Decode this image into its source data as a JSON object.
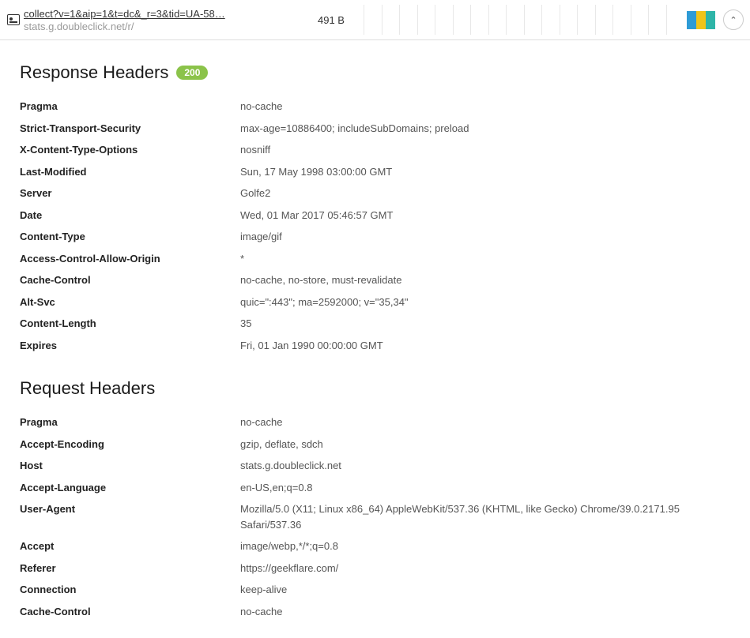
{
  "request": {
    "url": "collect?v=1&aip=1&t=dc&_r=3&tid=UA-58…",
    "host": "stats.g.doubleclick.net/r/",
    "size": "491 B"
  },
  "responseHeaders": {
    "title": "Response Headers",
    "status": "200",
    "items": [
      {
        "name": "Pragma",
        "value": "no-cache"
      },
      {
        "name": "Strict-Transport-Security",
        "value": "max-age=10886400; includeSubDomains; preload"
      },
      {
        "name": "X-Content-Type-Options",
        "value": "nosniff"
      },
      {
        "name": "Last-Modified",
        "value": "Sun, 17 May 1998 03:00:00 GMT"
      },
      {
        "name": "Server",
        "value": "Golfe2"
      },
      {
        "name": "Date",
        "value": "Wed, 01 Mar 2017 05:46:57 GMT"
      },
      {
        "name": "Content-Type",
        "value": "image/gif"
      },
      {
        "name": "Access-Control-Allow-Origin",
        "value": "*"
      },
      {
        "name": "Cache-Control",
        "value": "no-cache, no-store, must-revalidate"
      },
      {
        "name": "Alt-Svc",
        "value": "quic=\":443\"; ma=2592000; v=\"35,34\""
      },
      {
        "name": "Content-Length",
        "value": "35"
      },
      {
        "name": "Expires",
        "value": "Fri, 01 Jan 1990 00:00:00 GMT"
      }
    ]
  },
  "requestHeaders": {
    "title": "Request Headers",
    "items": [
      {
        "name": "Pragma",
        "value": "no-cache"
      },
      {
        "name": "Accept-Encoding",
        "value": "gzip, deflate, sdch"
      },
      {
        "name": "Host",
        "value": "stats.g.doubleclick.net"
      },
      {
        "name": "Accept-Language",
        "value": "en-US,en;q=0.8"
      },
      {
        "name": "User-Agent",
        "value": "Mozilla/5.0 (X11; Linux x86_64) AppleWebKit/537.36 (KHTML, like Gecko) Chrome/39.0.2171.95 Safari/537.36"
      },
      {
        "name": "Accept",
        "value": "image/webp,*/*;q=0.8"
      },
      {
        "name": "Referer",
        "value": "https://geekflare.com/"
      },
      {
        "name": "Connection",
        "value": "keep-alive"
      },
      {
        "name": "Cache-Control",
        "value": "no-cache"
      }
    ]
  },
  "timelineCells": 18
}
